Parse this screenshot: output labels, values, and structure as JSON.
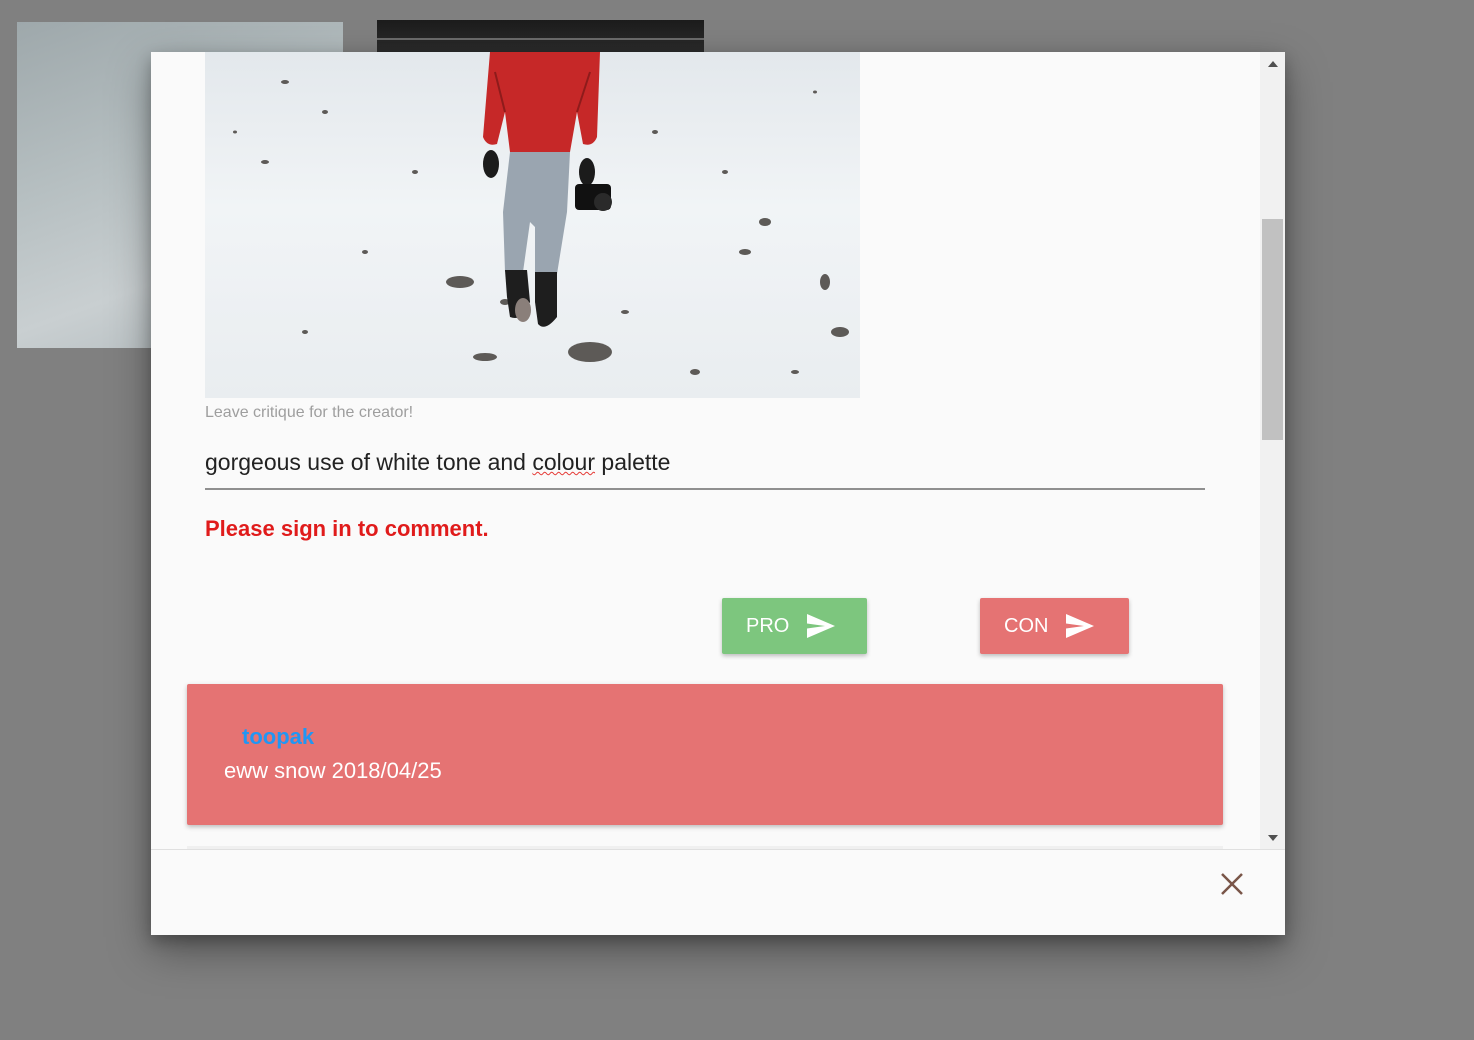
{
  "modal": {
    "caption": "Leave critique for the creator!",
    "comment_input": {
      "value_before": "gorgeous use of white tone and ",
      "value_misspelled": "colour",
      "value_after": " palette"
    },
    "error_message": "Please sign in to comment.",
    "pro_button": {
      "label": "PRO",
      "icon": "send-icon",
      "color": "#7dc67e"
    },
    "con_button": {
      "label": "CON",
      "icon": "send-icon",
      "color": "#e57373"
    },
    "comments": [
      {
        "user": "toopak",
        "text": "eww snow 2018/04/25",
        "stance_color": "#e57373",
        "user_color": "#2196f3"
      }
    ],
    "close_icon": "close-icon"
  },
  "colors": {
    "overlay": "#808080",
    "error": "#e01b1b"
  }
}
